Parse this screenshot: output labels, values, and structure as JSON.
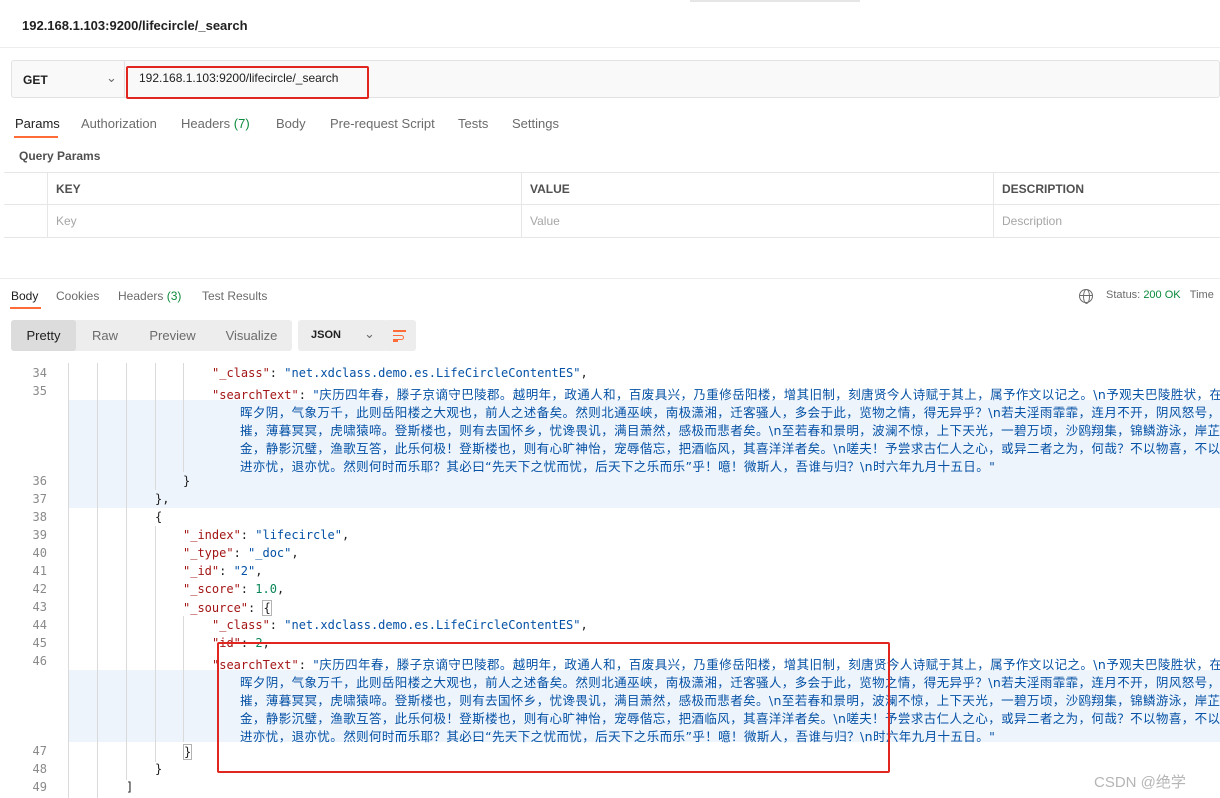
{
  "window": {
    "title": "192.168.1.103:9200/lifecircle/_search"
  },
  "request": {
    "method": "GET",
    "url": "192.168.1.103:9200/lifecircle/_search"
  },
  "request_tabs": [
    {
      "label": "Params",
      "count": "",
      "active": true
    },
    {
      "label": "Authorization",
      "count": ""
    },
    {
      "label": "Headers",
      "count": "(7)"
    },
    {
      "label": "Body",
      "count": ""
    },
    {
      "label": "Pre-request Script",
      "count": ""
    },
    {
      "label": "Tests",
      "count": ""
    },
    {
      "label": "Settings",
      "count": ""
    }
  ],
  "query_params": {
    "title": "Query Params",
    "headers": [
      "KEY",
      "VALUE",
      "DESCRIPTION"
    ],
    "placeholders": [
      "Key",
      "Value",
      "Description"
    ]
  },
  "response_tabs": [
    {
      "label": "Body",
      "count": "",
      "active": true
    },
    {
      "label": "Cookies",
      "count": ""
    },
    {
      "label": "Headers",
      "count": "(3)"
    },
    {
      "label": "Test Results",
      "count": ""
    }
  ],
  "status": {
    "label": "Status:",
    "value": "200 OK",
    "extra": "Time"
  },
  "view_modes": [
    "Pretty",
    "Raw",
    "Preview",
    "Visualize"
  ],
  "format": "JSON",
  "icons": {
    "globe": "globe-icon",
    "wrap": "wrap-lines-icon",
    "chevron": "chevron-down-icon"
  },
  "colors": {
    "accent": "#ff6c37",
    "status_ok": "#0b8a3c",
    "highlight_box": "#e0261f"
  },
  "line_numbers": [
    "34",
    "35",
    "36",
    "37",
    "38",
    "39",
    "40",
    "41",
    "42",
    "43",
    "44",
    "45",
    "46",
    "47",
    "48",
    "49"
  ],
  "code": {
    "l34": {
      "key": "\"_class\"",
      "sep": ": ",
      "val": "\"net.xdclass.demo.es.LifeCircleContentES\"",
      "end": ","
    },
    "l35": {
      "key": "\"searchText\"",
      "sep": ": ",
      "w": [
        "\"庆历四年春，滕子京谪守巴陵郡。越明年，政通人和，百废具兴，乃重修岳阳楼，增其旧制，刻唐贤今人诗赋于其上，属予作文以记之。\\n予观夫巴陵胜状，在洞庭一湖。",
        "晖夕阴，气象万千，此则岳阳楼之大观也，前人之述备矣。然则北通巫峡，南极潇湘，迁客骚人，多会于此，览物之情，得无异乎？\\n若夫淫雨霏霏，连月不开，阴风怒号，浊浪排空，日",
        "摧，薄暮冥冥，虎啸猿啼。登斯楼也，则有去国怀乡，忧谗畏讥，满目萧然，感极而悲者矣。\\n至若春和景明，波澜不惊，上下天光，一碧万顷，沙鸥翔集，锦鳞游泳，岸芷汀兰，郁郁青",
        "金，静影沉璧，渔歌互答，此乐何极！登斯楼也，则有心旷神怡，宠辱偕忘，把酒临风，其喜洋洋者矣。\\n嗟夫！予尝求古仁人之心，或异二者之为，何哉？不以物喜，不以己悲，居庙堂",
        "进亦忧，退亦忧。然则何时而乐耶？其必曰“先天下之忧而忧，后天下之乐而乐”乎！噫！微斯人，吾谁与归？\\n时六年九月十五日。\""
      ]
    },
    "l36": "}",
    "l37": "},",
    "l38": "{",
    "l39": {
      "key": "\"_index\"",
      "sep": ": ",
      "val": "\"lifecircle\"",
      "end": ","
    },
    "l40": {
      "key": "\"_type\"",
      "sep": ": ",
      "val": "\"_doc\"",
      "end": ","
    },
    "l41": {
      "key": "\"_id\"",
      "sep": ": ",
      "val": "\"2\"",
      "end": ","
    },
    "l42": {
      "key": "\"_score\"",
      "sep": ": ",
      "val": "1.0",
      "end": ","
    },
    "l43": {
      "key": "\"_source\"",
      "sep": ": ",
      "val": "{"
    },
    "l44": {
      "key": "\"_class\"",
      "sep": ": ",
      "val": "\"net.xdclass.demo.es.LifeCircleContentES\"",
      "end": ","
    },
    "l45": {
      "key": "\"id\"",
      "sep": ": ",
      "val": "2",
      "end": ","
    },
    "l46": {
      "key": "\"searchText\"",
      "sep": ": ",
      "w": [
        "\"庆历四年春，滕子京谪守巴陵郡。越明年，政通人和，百废具兴，乃重修岳阳楼，增其旧制，刻唐贤今人诗赋于其上，属予作文以记之。\\n予观夫巴陵胜状，在洞庭一湖。",
        "晖夕阴，气象万千，此则岳阳楼之大观也，前人之述备矣。然则北通巫峡，南极潇湘，迁客骚人，多会于此，览物之情，得无异乎？\\n若夫淫雨霏霏，连月不开，阴风怒号，浊浪排空，日",
        "摧，薄暮冥冥，虎啸猿啼。登斯楼也，则有去国怀乡，忧谗畏讥，满目萧然，感极而悲者矣。\\n至若春和景明，波澜不惊，上下天光，一碧万顷，沙鸥翔集，锦鳞游泳，岸芷汀兰，郁郁青",
        "金，静影沉璧，渔歌互答，此乐何极！登斯楼也，则有心旷神怡，宠辱偕忘，把酒临风，其喜洋洋者矣。\\n嗟夫！予尝求古仁人之心，或异二者之为，何哉？不以物喜，不以己悲，居庙堂",
        "进亦忧，退亦忧。然则何时而乐耶？其必曰“先天下之忧而忧，后天下之乐而乐”乎！噫！微斯人，吾谁与归？\\n时六年九月十五日。\""
      ]
    },
    "l47": "}",
    "l48": "}",
    "l49": "]"
  },
  "watermark": "CSDN @绝学"
}
